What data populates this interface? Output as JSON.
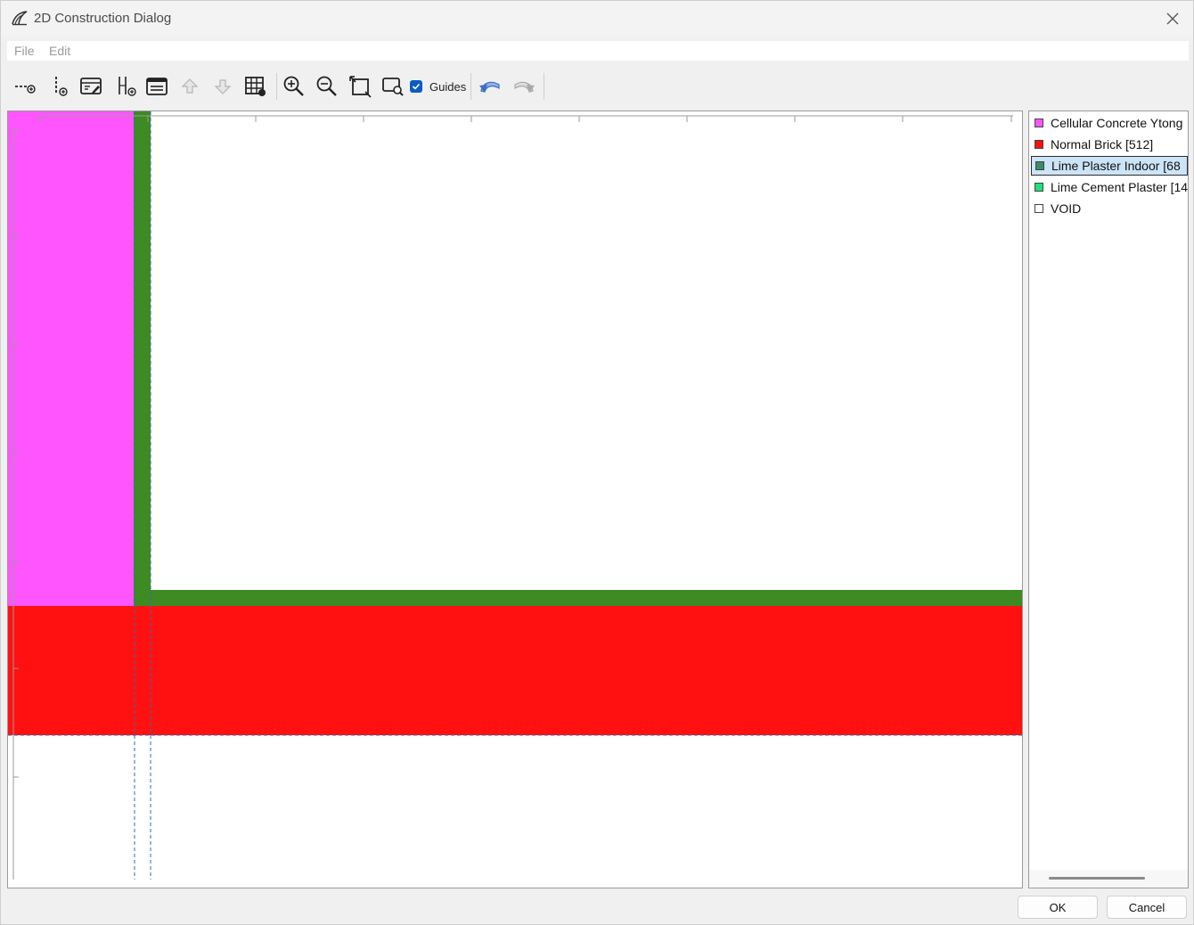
{
  "window": {
    "title": "2D Construction Dialog"
  },
  "menu": [
    {
      "label": "File"
    },
    {
      "label": "Edit"
    }
  ],
  "toolbar": {
    "guides_label": "Guides",
    "guides_checked": true
  },
  "materials": [
    {
      "label": "Cellular Concrete Ytong",
      "color": "#ff55ff",
      "selected": false
    },
    {
      "label": "Normal Brick [512]",
      "color": "#ff1010",
      "selected": false
    },
    {
      "label": "Lime Plaster Indoor [68",
      "color": "#3d8a6a",
      "selected": true
    },
    {
      "label": "Lime Cement Plaster [14",
      "color": "#22e07a",
      "selected": false
    },
    {
      "label": "VOID",
      "color": "#ffffff",
      "selected": false
    }
  ],
  "canvas": {
    "colors": {
      "cellular_concrete": "#ff55ff",
      "normal_brick": "#ff1111",
      "lime_plaster": "#3d8b22",
      "guide": "#2a6fb0"
    }
  },
  "buttons": {
    "ok": "OK",
    "cancel": "Cancel"
  }
}
